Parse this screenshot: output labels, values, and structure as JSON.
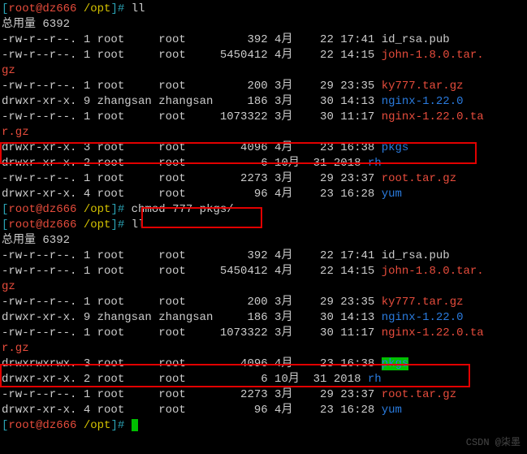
{
  "prompt1": {
    "lb": "[",
    "user": "root@dz666",
    "sp": " ",
    "path": "/opt",
    "rb": "]# ",
    "cmd": "ll"
  },
  "total1": "总用量 6392",
  "ls1": [
    {
      "perm": "-rw-r--r--.",
      "links": " 1",
      "owner": "root",
      "group": "root",
      "size": "    392",
      "month": "4月",
      "day": "  22",
      "time": "17:41",
      "name": "id_rsa.pub",
      "ncls": "white"
    },
    {
      "perm": "-rw-r--r--.",
      "links": " 1",
      "owner": "root",
      "group": "root",
      "size": "5450412",
      "month": "4月",
      "day": "  22",
      "time": "14:15",
      "name": "john-1.8.0.tar.",
      "wrap": "gz",
      "ncls": "red"
    },
    {
      "perm": "-rw-r--r--.",
      "links": " 1",
      "owner": "root",
      "group": "root",
      "size": "    200",
      "month": "3月",
      "day": "  29",
      "time": "23:35",
      "name": "ky777.tar.gz",
      "ncls": "red"
    },
    {
      "perm": "drwxr-xr-x.",
      "links": " 9",
      "owner": "zhangsan",
      "group": "zhangsan",
      "size": "    186",
      "month": "3月",
      "day": "  30",
      "time": "14:13",
      "name": "nginx-1.22.0",
      "ncls": "blue"
    },
    {
      "perm": "-rw-r--r--.",
      "links": " 1",
      "owner": "root",
      "group": "root",
      "size": "1073322",
      "month": "3月",
      "day": "  30",
      "time": "11:17",
      "name": "nginx-1.22.0.ta",
      "wrap": "r.gz",
      "ncls": "red"
    },
    {
      "perm": "drwxr-xr-x.",
      "links": " 3",
      "owner": "root",
      "group": "root",
      "size": "   4096",
      "month": "4月",
      "day": "  23",
      "time": "16:38",
      "name": "pkgs",
      "ncls": "blue"
    },
    {
      "perm": "drwxr-xr-x.",
      "links": " 2",
      "owner": "root",
      "group": "root",
      "size": "      6",
      "month": "10月",
      "day": " 31",
      "time": "2018",
      "name": "rh",
      "ncls": "blue"
    },
    {
      "perm": "-rw-r--r--.",
      "links": " 1",
      "owner": "root",
      "group": "root",
      "size": "   2273",
      "month": "3月",
      "day": "  29",
      "time": "23:37",
      "name": "root.tar.gz",
      "ncls": "red"
    },
    {
      "perm": "drwxr-xr-x.",
      "links": " 4",
      "owner": "root",
      "group": "root",
      "size": "     96",
      "month": "4月",
      "day": "  23",
      "time": "16:28",
      "name": "yum",
      "ncls": "blue"
    }
  ],
  "prompt2": {
    "lb": "[",
    "user": "root@dz666",
    "sp": " ",
    "path": "/opt",
    "rb": "]# ",
    "cmd": "chmod 777 pkgs/"
  },
  "prompt3": {
    "lb": "[",
    "user": "root@dz666",
    "sp": " ",
    "path": "/opt",
    "rb": "]# ",
    "cmd": "ll"
  },
  "total2": "总用量 6392",
  "ls2": [
    {
      "perm": "-rw-r--r--.",
      "links": " 1",
      "owner": "root",
      "group": "root",
      "size": "    392",
      "month": "4月",
      "day": "  22",
      "time": "17:41",
      "name": "id_rsa.pub",
      "ncls": "white"
    },
    {
      "perm": "-rw-r--r--.",
      "links": " 1",
      "owner": "root",
      "group": "root",
      "size": "5450412",
      "month": "4月",
      "day": "  22",
      "time": "14:15",
      "name": "john-1.8.0.tar.",
      "wrap": "gz",
      "ncls": "red"
    },
    {
      "perm": "-rw-r--r--.",
      "links": " 1",
      "owner": "root",
      "group": "root",
      "size": "    200",
      "month": "3月",
      "day": "  29",
      "time": "23:35",
      "name": "ky777.tar.gz",
      "ncls": "red"
    },
    {
      "perm": "drwxr-xr-x.",
      "links": " 9",
      "owner": "zhangsan",
      "group": "zhangsan",
      "size": "    186",
      "month": "3月",
      "day": "  30",
      "time": "14:13",
      "name": "nginx-1.22.0",
      "ncls": "blue"
    },
    {
      "perm": "-rw-r--r--.",
      "links": " 1",
      "owner": "root",
      "group": "root",
      "size": "1073322",
      "month": "3月",
      "day": "  30",
      "time": "11:17",
      "name": "nginx-1.22.0.ta",
      "wrap": "r.gz",
      "ncls": "red"
    },
    {
      "perm": "drwxrwxrwx.",
      "links": " 3",
      "owner": "root",
      "group": "root",
      "size": "   4096",
      "month": "4月",
      "day": "  23",
      "time": "16:38",
      "name": "pkgs",
      "ncls": "greenbg"
    },
    {
      "perm": "drwxr-xr-x.",
      "links": " 2",
      "owner": "root",
      "group": "root",
      "size": "      6",
      "month": "10月",
      "day": " 31",
      "time": "2018",
      "name": "rh",
      "ncls": "blue"
    },
    {
      "perm": "-rw-r--r--.",
      "links": " 1",
      "owner": "root",
      "group": "root",
      "size": "   2273",
      "month": "3月",
      "day": "  29",
      "time": "23:37",
      "name": "root.tar.gz",
      "ncls": "red"
    },
    {
      "perm": "drwxr-xr-x.",
      "links": " 4",
      "owner": "root",
      "group": "root",
      "size": "     96",
      "month": "4月",
      "day": "  23",
      "time": "16:28",
      "name": "yum",
      "ncls": "blue"
    }
  ],
  "prompt4": {
    "lb": "[",
    "user": "root@dz666",
    "sp": " ",
    "path": "/opt",
    "rb": "]# "
  },
  "watermark": "CSDN @柒墨"
}
